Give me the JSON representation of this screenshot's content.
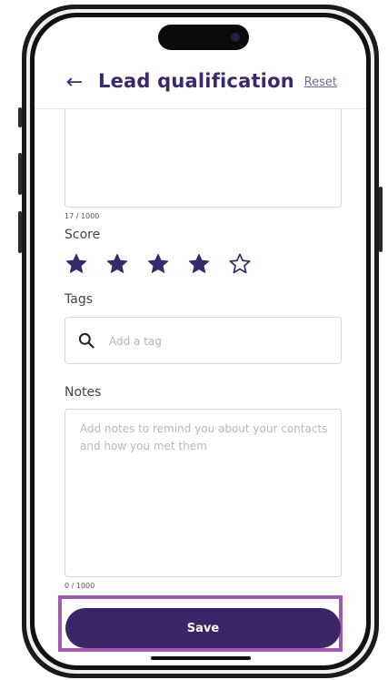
{
  "colors": {
    "brand": "#3b2a6b",
    "save_button": "#3b2566",
    "highlight_frame": "#a05bb0",
    "star_filled": "#3b2a6b"
  },
  "header": {
    "back_icon": "arrow-left-icon",
    "back_symbol": "←",
    "title": "Lead qualification",
    "reset_label": "Reset"
  },
  "description": {
    "counter": "17 / 1000"
  },
  "score": {
    "label": "Score",
    "rating": 4,
    "max": 5
  },
  "tags": {
    "label": "Tags",
    "search_icon": "search-icon",
    "placeholder": "Add a tag"
  },
  "notes": {
    "label": "Notes",
    "placeholder": "Add notes to remind you about your contacts and how you met them",
    "counter": "0 / 1000"
  },
  "footer": {
    "save_label": "Save"
  }
}
